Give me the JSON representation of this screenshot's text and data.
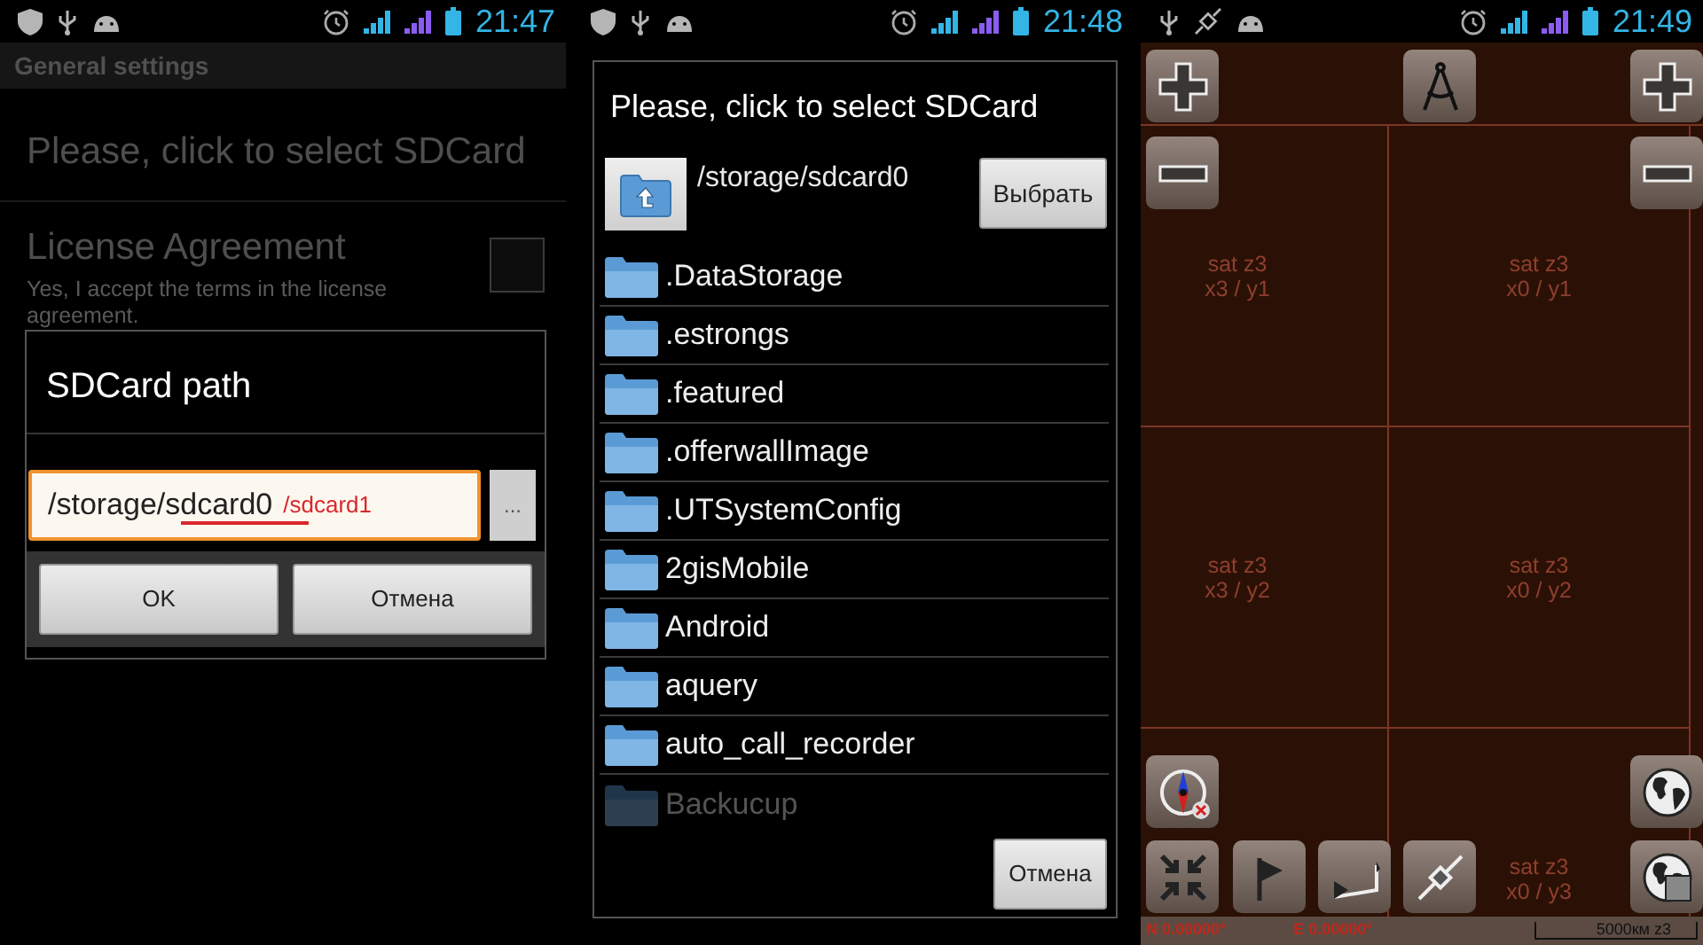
{
  "screens": [
    {
      "status_bar": {
        "notifications": [
          {
            "kind": "shield"
          },
          {
            "kind": "usb"
          },
          {
            "kind": "android"
          }
        ],
        "time": "21:47"
      },
      "title_bar": "General settings",
      "settings": [
        {
          "title": "Please, click to select SDCard"
        },
        {
          "title": "License Agreement",
          "summary": "Yes, I accept the terms in the license agreement.",
          "checked": false
        }
      ],
      "dialog": {
        "title": "SDCard path",
        "path_field": {
          "value": "/storage/sdcard0",
          "focused": true
        },
        "annotation": "/sdcard1",
        "browse_button": "...",
        "buttons": [
          "OK",
          "Отмена"
        ]
      }
    },
    {
      "status_bar": {
        "notifications": [
          {
            "kind": "shield"
          },
          {
            "kind": "usb"
          },
          {
            "kind": "android"
          }
        ],
        "time": "21:48"
      },
      "dialog": {
        "title": "Please, click to select SDCard",
        "current_path": "/storage/sdcard0",
        "select_button": "Выбрать",
        "folders": [
          {
            "name": ".DataStorage"
          },
          {
            "name": ".estrongs"
          },
          {
            "name": ".featured"
          },
          {
            "name": ".offerwallImage"
          },
          {
            "name": ".UTSystemConfig"
          },
          {
            "name": "2gisMobile"
          },
          {
            "name": "Android"
          },
          {
            "name": "aquery"
          },
          {
            "name": "auto_call_recorder"
          },
          {
            "name": "Backucup"
          }
        ],
        "cancel_button": "Отмена"
      }
    },
    {
      "status_bar": {
        "notifications": [
          {
            "kind": "usb"
          },
          {
            "kind": "satellite"
          },
          {
            "kind": "android"
          }
        ],
        "time": "21:49"
      },
      "map": {
        "tiles": [
          {
            "kind": "labeled",
            "label": "sat z3",
            "coords": "x3 / y1"
          },
          {
            "kind": "labeled",
            "label": "sat z3",
            "coords": "x0 / y1"
          },
          {
            "kind": "labeled",
            "label": "sat z3",
            "coords": "x3 / y2"
          },
          {
            "kind": "labeled",
            "label": "sat z3",
            "coords": "x0 / y2"
          },
          {
            "kind": "blank"
          },
          {
            "kind": "labeled",
            "label": "sat z3",
            "coords": "x0 / y3"
          }
        ],
        "latitude": "N 0.00000°",
        "longitude": "E 0.00000°",
        "scale": "5000км z3"
      }
    }
  ]
}
